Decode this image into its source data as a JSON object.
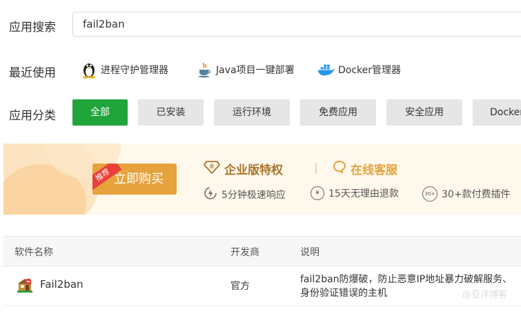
{
  "search": {
    "label": "应用搜索",
    "value": "fail2ban"
  },
  "recent": {
    "label": "最近使用",
    "items": [
      {
        "label": "进程守护管理器",
        "icon": "linux-penguin-icon"
      },
      {
        "label": "Java项目一键部署",
        "icon": "java-cup-icon"
      },
      {
        "label": "Docker管理器",
        "icon": "docker-whale-icon"
      }
    ]
  },
  "categories": {
    "label": "应用分类",
    "items": [
      {
        "label": "全部",
        "active": true
      },
      {
        "label": "已安装",
        "active": false
      },
      {
        "label": "运行环境",
        "active": false
      },
      {
        "label": "免费应用",
        "active": false
      },
      {
        "label": "安全应用",
        "active": false
      },
      {
        "label": "Docker",
        "active": false
      }
    ]
  },
  "banner": {
    "buy_label": "立即购买",
    "ribbon": "推荐",
    "enterprise": "企业版特权",
    "divider": "|",
    "online_service": "在线客服",
    "features": [
      {
        "label": "5分钟极速响应",
        "icon": "lightning-clock-icon"
      },
      {
        "label": "15天无理由退款",
        "icon": "yen-refund-icon",
        "glyph": "¥"
      },
      {
        "label": "30+款付费插件",
        "icon": "plugins-30-icon",
        "glyph": "30+"
      }
    ],
    "colors": {
      "gold": "#a8742a",
      "orange": "#e6a23c",
      "ribbon": "#e8413a"
    }
  },
  "table": {
    "headers": [
      "软件名称",
      "开发商",
      "说明"
    ],
    "rows": [
      {
        "name": "Fail2ban",
        "developer": "官方",
        "desc_line1": "fail2ban防爆破，防止恶意IP地址暴力破解服务、",
        "desc_line2": "身份验证错误的主机"
      }
    ]
  },
  "watermark": "@亚洋博客",
  "accent": "#20a53a"
}
